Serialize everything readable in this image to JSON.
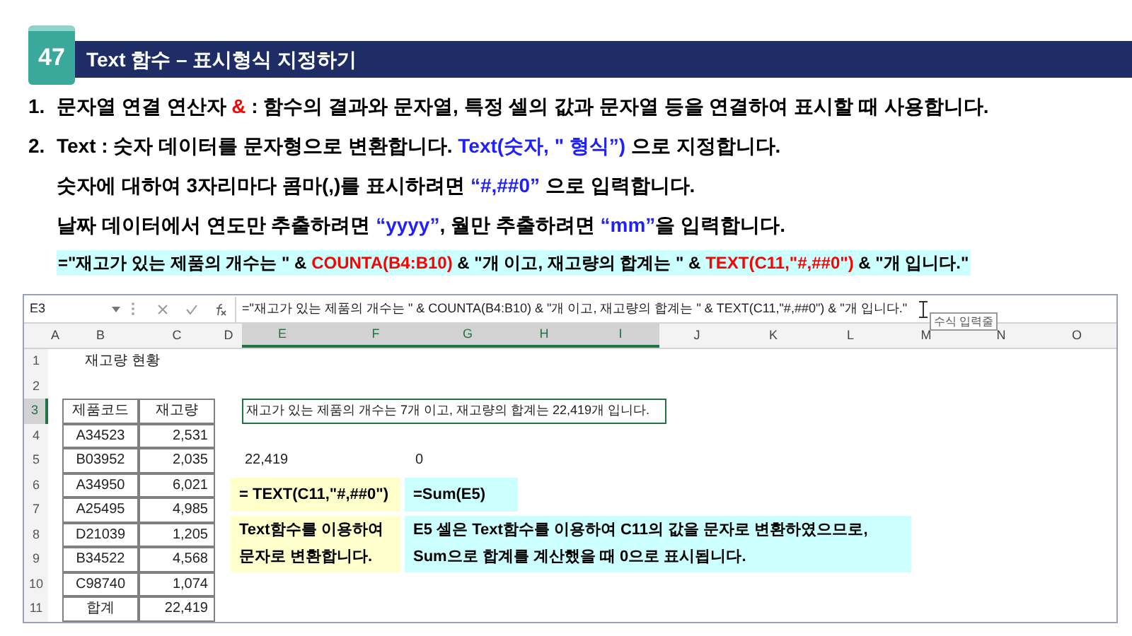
{
  "header": {
    "number": "47",
    "title": "Text 함수 – 표시형식 지정하기"
  },
  "points": [
    {
      "marker": "1.",
      "segments": [
        {
          "kind": "plain",
          "text": "문자열 연결 연산자 "
        },
        {
          "kind": "operator",
          "text": "&"
        },
        {
          "kind": "plain",
          "text": " : 함수의 결과와 문자열, 특정 셀의 값과 문자열 등을 연결하여 표시할 때 사용합니다."
        }
      ]
    },
    {
      "marker": "2.",
      "segments": [
        {
          "kind": "plain",
          "text": "Text : 숫자 데이터를 문자형으로 변환합니다. "
        },
        {
          "kind": "code",
          "text": "Text(숫자,  \" 형식”)"
        },
        {
          "kind": "plain",
          "text": " 으로 지정합니다."
        }
      ]
    },
    {
      "segments": [
        {
          "kind": "plain",
          "text": "숫자에 대하여 3자리마다 콤마(,)를 표시하려면 "
        },
        {
          "kind": "code",
          "text": "“#,##0”"
        },
        {
          "kind": "plain",
          "text": " 으로 입력합니다."
        }
      ]
    },
    {
      "segments": [
        {
          "kind": "plain",
          "text": "날짜 데이터에서 연도만 추출하려면 "
        },
        {
          "kind": "code",
          "text": "“yyyy”"
        },
        {
          "kind": "plain",
          "text": ", 월만 추출하려면 "
        },
        {
          "kind": "code",
          "text": "“mm”"
        },
        {
          "kind": "plain",
          "text": "을 입력합니다."
        }
      ]
    }
  ],
  "formula_example": [
    {
      "kind": "plain",
      "text": "=\"재고가 있는 제품의 개수는 \" & "
    },
    {
      "kind": "function",
      "text": "COUNTA(B4:B10)"
    },
    {
      "kind": "plain",
      "text": " & \"개 이고, 재고량의 합계는 \" & "
    },
    {
      "kind": "function",
      "text": "TEXT(C11,\"#,##0\")"
    },
    {
      "kind": "plain",
      "text": " & \"개 입니다.\""
    }
  ],
  "sheet": {
    "name_box": "E3",
    "formula": "=\"재고가 있는 제품의 개수는 \" & COUNTA(B4:B10) & \"개 이고, 재고량의 합계는 \" & TEXT(C11,\"#,##0\") & \"개 입니다.\"",
    "tooltip": "수식 입력줄",
    "columns": [
      {
        "label": "A",
        "selected": false
      },
      {
        "label": "B",
        "selected": false
      },
      {
        "label": "C",
        "selected": false
      },
      {
        "label": "D",
        "selected": false
      },
      {
        "label": "E",
        "selected": true
      },
      {
        "label": "F",
        "selected": true
      },
      {
        "label": "G",
        "selected": true
      },
      {
        "label": "H",
        "selected": true
      },
      {
        "label": "I",
        "selected": true
      },
      {
        "label": "J",
        "selected": false
      },
      {
        "label": "K",
        "selected": false
      },
      {
        "label": "L",
        "selected": false
      },
      {
        "label": "M",
        "selected": false
      },
      {
        "label": "N",
        "selected": false
      },
      {
        "label": "O",
        "selected": false
      }
    ],
    "rows": [
      {
        "label": "1",
        "selected": false
      },
      {
        "label": "2",
        "selected": false
      },
      {
        "label": "3",
        "selected": true
      },
      {
        "label": "4",
        "selected": false
      },
      {
        "label": "5",
        "selected": false
      },
      {
        "label": "6",
        "selected": false
      },
      {
        "label": "7",
        "selected": false
      },
      {
        "label": "8",
        "selected": false
      },
      {
        "label": "9",
        "selected": false
      },
      {
        "label": "10",
        "selected": false
      },
      {
        "label": "11",
        "selected": false
      }
    ],
    "title": "재고량 현황",
    "table": {
      "header": [
        "제품코드",
        "재고량"
      ],
      "rows": [
        [
          "A34523",
          "2,531"
        ],
        [
          "B03952",
          "2,035"
        ],
        [
          "A34950",
          "6,021"
        ],
        [
          "A25495",
          "4,985"
        ],
        [
          "D21039",
          "1,205"
        ],
        [
          "B34522",
          "4,568"
        ],
        [
          "C98740",
          "1,074"
        ]
      ],
      "total": [
        "합계",
        "22,419"
      ]
    },
    "value_cells": [
      "22,419",
      "0"
    ],
    "result_box": "재고가 있는 제품의 개수는 7개 이고, 재고량의 합계는 22,419개 입니다.",
    "notes": [
      {
        "lines": [
          "= TEXT(C11,\"#,##0\")"
        ],
        "color": "#ffffcc"
      },
      {
        "lines": [
          "=Sum(E5)"
        ],
        "color": "#ccffff"
      },
      {
        "lines": [
          "Text함수를 이용하여",
          "문자로 변환합니다."
        ],
        "color": "#ffffcc"
      },
      {
        "lines": [
          "E5 셀은 Text함수를 이용하여 C11의 값을 문자로 변환하였으므로,",
          "Sum으로 합계를   계산했을 때 0으로 표시됩니다."
        ],
        "color": "#ccffff"
      }
    ]
  }
}
